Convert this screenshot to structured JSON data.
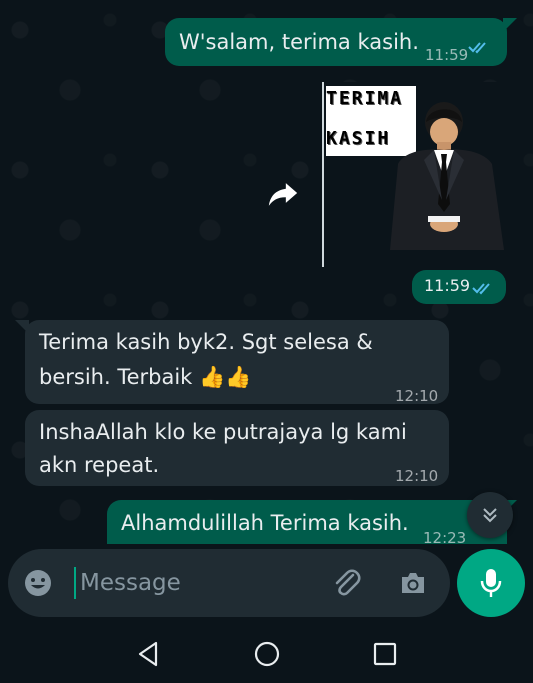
{
  "messages": [
    {
      "direction": "outgoing",
      "text": "W'salam, terima kasih.",
      "time": "11:59",
      "status": "read"
    },
    {
      "direction": "outgoing",
      "type": "sticker",
      "sticker_text_line1": "TERIMA",
      "sticker_text_line2": "KASIH",
      "time": "11:59",
      "status": "read"
    },
    {
      "direction": "incoming",
      "text_line1": "Terima kasih byk2. Sgt selesa &",
      "text_line2": "bersih. Terbaik 👍👍",
      "time": "12:10"
    },
    {
      "direction": "incoming",
      "text_line1": "InshaAllah klo ke putrajaya lg kami",
      "text_line2": "akn repeat.",
      "time": "12:10"
    },
    {
      "direction": "outgoing",
      "text": "Alhamdulillah Terima kasih.",
      "time": "12:23",
      "status": "read"
    }
  ],
  "composer": {
    "placeholder": "Message",
    "emoji_icon": "emoji-icon",
    "attach_icon": "paperclip-icon",
    "camera_icon": "camera-icon",
    "mic_icon": "microphone-icon"
  },
  "colors": {
    "background": "#0b141a",
    "outgoing_bubble": "#005c4b",
    "incoming_bubble": "#202c33",
    "accent": "#00a884",
    "read_ticks": "#53bdeb"
  }
}
